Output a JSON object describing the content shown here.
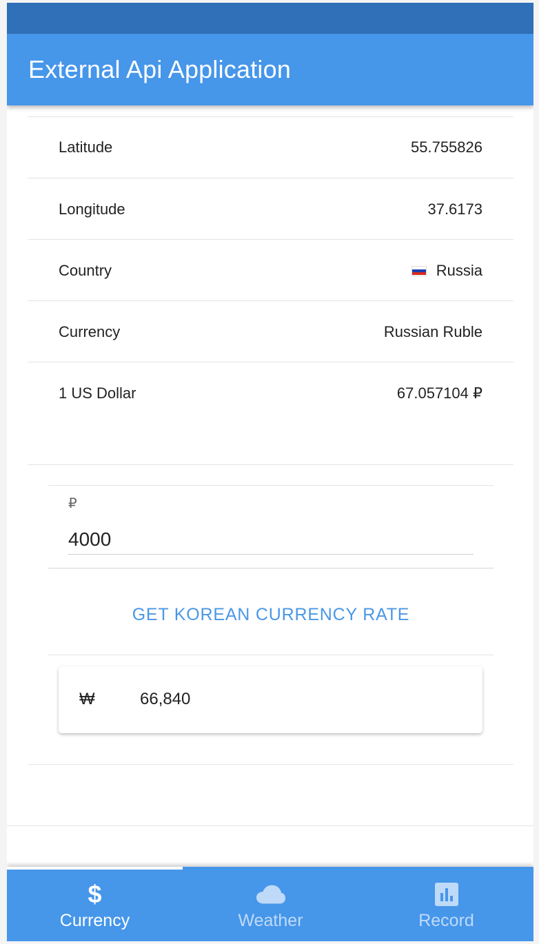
{
  "app": {
    "title": "External Api Application"
  },
  "info_rows": [
    {
      "label": "Latitude",
      "value": "55.755826"
    },
    {
      "label": "Longitude",
      "value": "37.6173"
    },
    {
      "label": "Country",
      "value": "Russia",
      "icon": "russia-flag-icon"
    },
    {
      "label": "Currency",
      "value": "Russian Ruble"
    },
    {
      "label": "1 US Dollar",
      "value": "67.057104 ₽"
    }
  ],
  "converter": {
    "input_label": "₽",
    "input_value": "4000",
    "button_label": "GET KOREAN CURRENCY RATE",
    "result_symbol": "₩",
    "result_value": "66,840"
  },
  "tabs": [
    {
      "label": "Currency",
      "icon": "dollar-icon",
      "active": true
    },
    {
      "label": "Weather",
      "icon": "cloud-icon",
      "active": false
    },
    {
      "label": "Record",
      "icon": "bar-chart-icon",
      "active": false
    }
  ],
  "colors": {
    "primary": "#4696ea",
    "status_bar": "#2f70b8",
    "accent_text": "#4a97e6"
  }
}
